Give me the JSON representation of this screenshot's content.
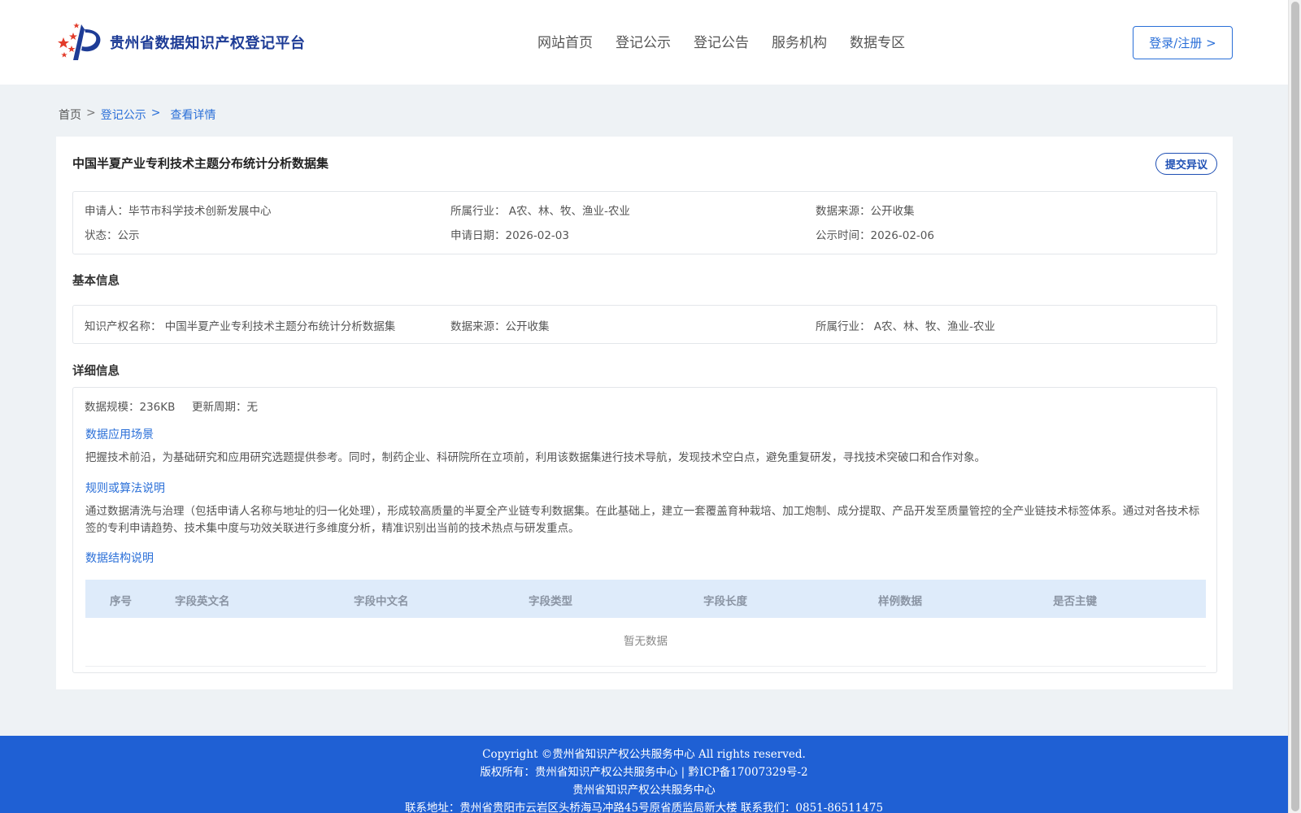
{
  "header": {
    "site_name": "贵州省数据知识产权登记平台",
    "nav": [
      "网站首页",
      "登记公示",
      "登记公告",
      "服务机构",
      "数据专区"
    ],
    "login_label": "登录/注册 >"
  },
  "breadcrumb": {
    "home": "首页",
    "sep": ">",
    "level2": "登记公示",
    "current": "查看详情"
  },
  "detail": {
    "title": "中国半夏产业专利技术主题分布统计分析数据集",
    "objection_label": "提交异议",
    "summary": {
      "applicant_label": "申请人：",
      "applicant": "毕节市科学技术创新发展中心",
      "industry_label": "所属行业：",
      "industry": "A农、林、牧、渔业-农业",
      "source_label": "数据来源：",
      "source": "公开收集",
      "status_label": "状态：",
      "status": "公示",
      "apply_date_label": "申请日期：",
      "apply_date": "2026-02-03",
      "publish_date_label": "公示时间：",
      "publish_date": "2026-02-06"
    },
    "basic": {
      "section_title": "基本信息",
      "ip_name_label": "知识产权名称：",
      "ip_name": "中国半夏产业专利技术主题分布统计分析数据集",
      "source_label": "数据来源：",
      "source": "公开收集",
      "industry_label": "所属行业：",
      "industry": "A农、林、牧、渔业-农业"
    },
    "extra": {
      "section_title": "详细信息",
      "scale_label": "数据规模：",
      "scale": "236KB",
      "cycle_label": "更新周期：",
      "cycle": "无",
      "scene_title": "数据应用场景",
      "scene_text": "把握技术前沿，为基础研究和应用研究选题提供参考。同时，制药企业、科研院所在立项前，利用该数据集进行技术导航，发现技术空白点，避免重复研发，寻找技术突破口和合作对象。",
      "rule_title": "规则或算法说明",
      "rule_text": "通过数据清洗与治理（包括申请人名称与地址的归一化处理），形成较高质量的半夏全产业链专利数据集。在此基础上，建立一套覆盖育种栽培、加工炮制、成分提取、产品开发至质量管控的全产业链技术标签体系。通过对各技术标签的专利申请趋势、技术集中度与功效关联进行多维度分析，精准识别出当前的技术热点与研发重点。",
      "struct_title": "数据结构说明",
      "columns": [
        "序号",
        "字段英文名",
        "字段中文名",
        "字段类型",
        "字段长度",
        "样例数据",
        "是否主键"
      ],
      "empty_text": "暂无数据"
    }
  },
  "footer": {
    "line1": "Copyright ©贵州省知识产权公共服务中心 All rights reserved.",
    "line2": "版权所有：贵州省知识产权公共服务中心 | 黔ICP备17007329号-2",
    "line3": "贵州省知识产权公共服务中心",
    "line4": "联系地址：贵州省贵阳市云岩区头桥海马冲路45号原省质监局新大楼 联系我们：0851-86511475"
  }
}
